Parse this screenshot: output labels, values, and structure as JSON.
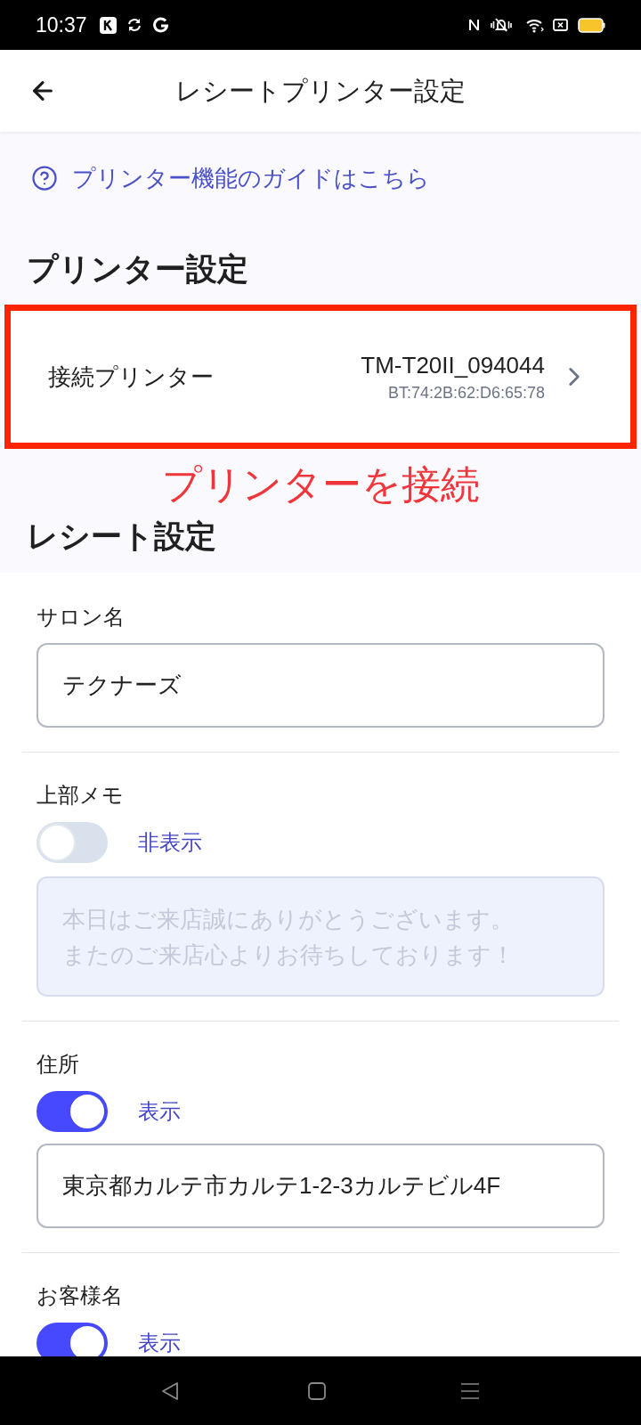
{
  "status_bar": {
    "time": "10:37"
  },
  "header": {
    "title": "レシートプリンター設定"
  },
  "guide_link": {
    "label": "プリンター機能のガイドはこちら"
  },
  "printer_section": {
    "heading": "プリンター設定",
    "connected_printer": {
      "label": "接続プリンター",
      "name": "TM-T20II_094044",
      "address": "BT:74:2B:62:D6:65:78"
    }
  },
  "annotation": {
    "text": "プリンターを接続"
  },
  "receipt_section": {
    "heading": "レシート設定",
    "fields": [
      {
        "kind": "text",
        "label": "サロン名",
        "value": "テクナーズ"
      },
      {
        "kind": "toggle_textarea",
        "label": "上部メモ",
        "on": false,
        "state_label": "非表示",
        "lines": [
          "本日はご来店誠にありがとうございます。",
          "またのご来店心よりお待ちしております！"
        ]
      },
      {
        "kind": "toggle_text",
        "label": "住所",
        "on": true,
        "state_label": "表示",
        "value": "東京都カルテ市カルテ1-2-3カルテビル4F"
      },
      {
        "kind": "toggle",
        "label": "お客様名",
        "on": true,
        "state_label": "表示"
      }
    ]
  }
}
